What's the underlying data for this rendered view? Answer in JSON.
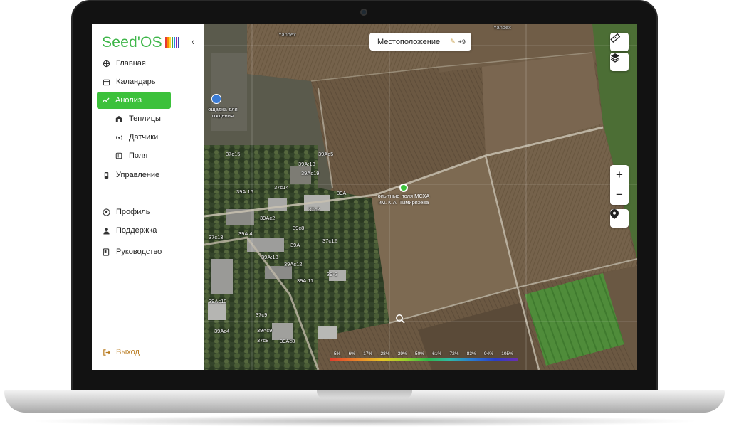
{
  "app": {
    "logo_text": "Seed'OS",
    "logo_bar_colors": [
      "#e53935",
      "#fb8c00",
      "#fdd835",
      "#43a047",
      "#1e88e5",
      "#8e24aa",
      "#3949ab"
    ]
  },
  "sidebar": {
    "items": [
      {
        "label": "Главная",
        "icon": "globe-icon"
      },
      {
        "label": "Каландарь",
        "icon": "calendar-icon"
      },
      {
        "label": "Анолиз",
        "icon": "chart-line-icon",
        "active": true
      },
      {
        "label": "Теплицы",
        "icon": "greenhouse-icon",
        "sub": true
      },
      {
        "label": "Датчики",
        "icon": "sensor-icon",
        "sub": true
      },
      {
        "label": "Поля",
        "icon": "field-icon",
        "sub": true
      },
      {
        "label": "Управление",
        "icon": "device-icon"
      },
      {
        "label": "Профиль",
        "icon": "user-circle-icon"
      },
      {
        "label": "Поддержка",
        "icon": "support-icon"
      },
      {
        "label": "Руководство",
        "icon": "book-icon"
      }
    ],
    "logout_label": "Выход",
    "collapse_glyph": "‹"
  },
  "map": {
    "location_label": "Местоположение",
    "location_count": "+9",
    "field_label": "опытные поля МСХА им. К.А. Тимирязева",
    "poi_label": "ощадка для ождения",
    "watermark": "Yandex",
    "parcel_labels": [
      "37с15",
      "39Ас5",
      "39А:18",
      "39Ас19",
      "37с14",
      "39А:16",
      "39А",
      "37с2",
      "39Ас2",
      "39с8",
      "39А:4",
      "37с13",
      "37с12",
      "39А",
      "39А:13",
      "39Ас12",
      "39-2",
      "39А:11",
      "39Ас10",
      "37с9",
      "39Ас9",
      "39Ас4",
      "37с8",
      "39Ас8"
    ],
    "legend": [
      "5%",
      "6%",
      "17%",
      "28%",
      "39%",
      "50%",
      "61%",
      "72%",
      "83%",
      "94%",
      "105%"
    ],
    "zoom_in": "+",
    "zoom_out": "−"
  }
}
